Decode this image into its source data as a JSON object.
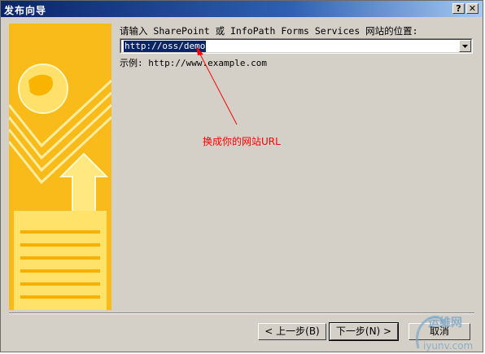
{
  "window": {
    "title": "发布向导",
    "help_glyph": "?",
    "close_glyph": "✕"
  },
  "form": {
    "prompt": "请输入 SharePoint 或 InfoPath Forms Services 网站的位置:",
    "url_value": "http://oss/demo",
    "example": "示例: http://www.example.com"
  },
  "annotation": {
    "text": "换成你的网站URL",
    "color": "#ff0000"
  },
  "buttons": {
    "back": "< 上一步(B)",
    "next": "下一步(N) >",
    "cancel": "取消"
  },
  "watermark": {
    "line1": "运维网",
    "line2": "iyunv.com"
  },
  "colors": {
    "titlebar": "#0a246a",
    "dialog": "#d4d0c8",
    "banner": "#f7b500",
    "selection": "#0a246a"
  }
}
